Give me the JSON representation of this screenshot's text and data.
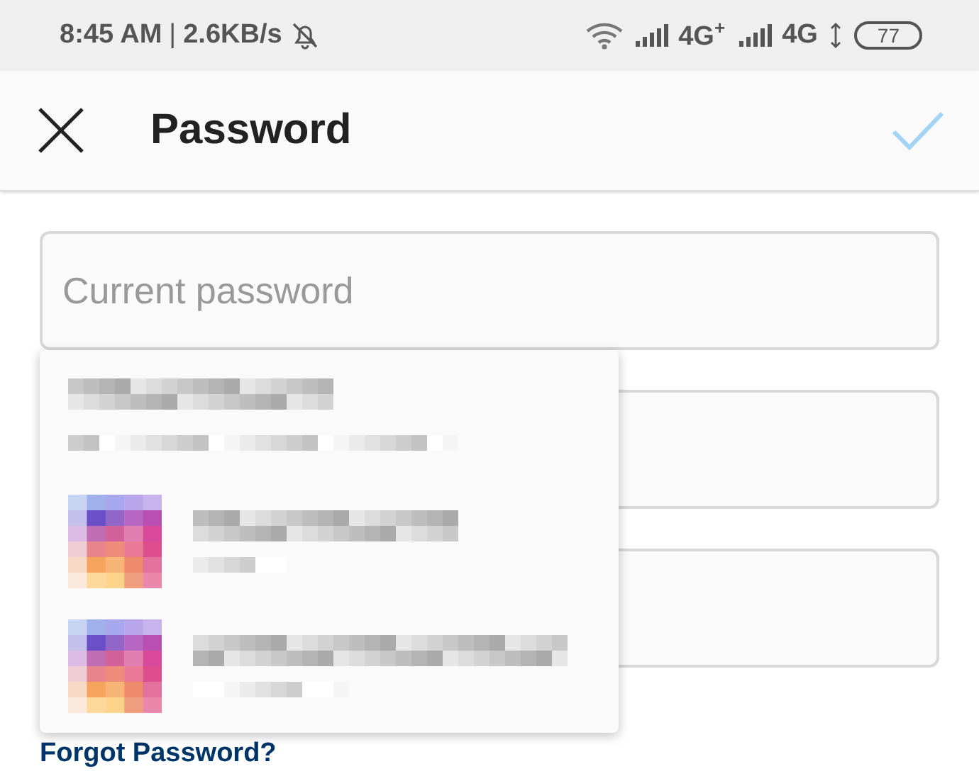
{
  "status_bar": {
    "time": "8:45 AM",
    "separator": "|",
    "speed": "2.6KB/s",
    "networks": [
      {
        "label": "4G",
        "mark": "+"
      },
      {
        "label": "4G"
      }
    ],
    "battery": "77"
  },
  "header": {
    "title": "Password"
  },
  "fields": [
    {
      "kind": "password",
      "placeholder": "Current password"
    },
    {
      "kind": "password"
    },
    {
      "kind": "password"
    }
  ],
  "forgot_link": "Forgot Password?",
  "suggestions": [
    {
      "kind": "account"
    },
    {
      "kind": "app"
    },
    {
      "kind": "app"
    }
  ]
}
